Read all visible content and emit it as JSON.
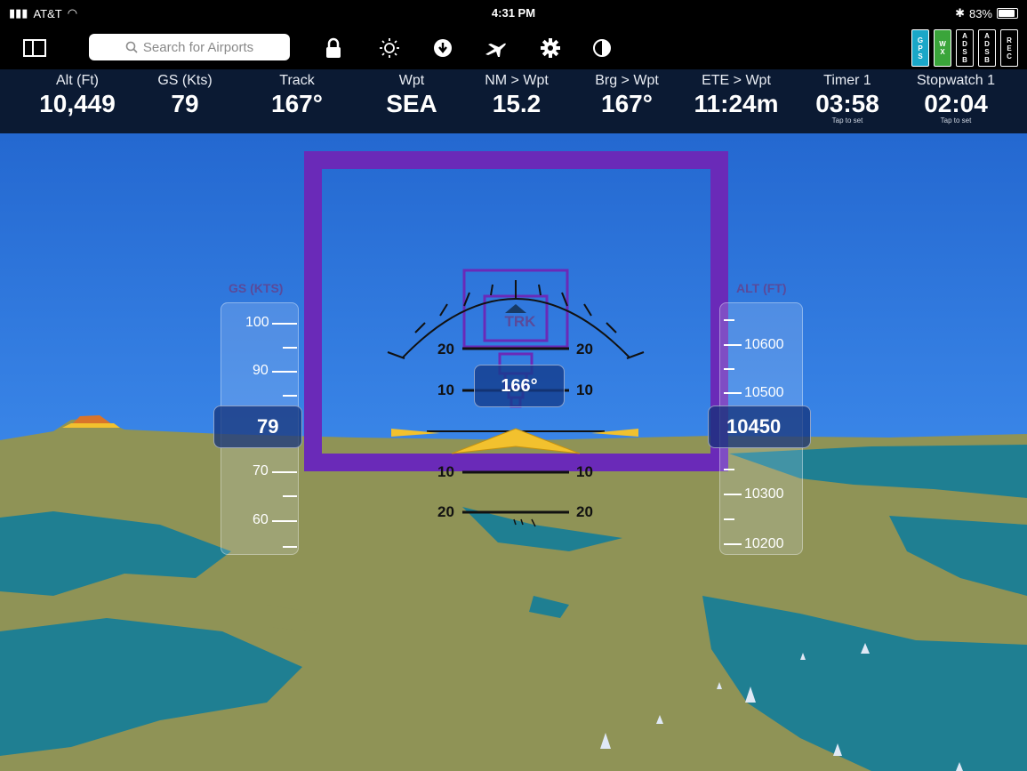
{
  "status": {
    "carrier": "AT&T",
    "time": "4:31 PM",
    "bluetooth": "✱",
    "battery": "83%"
  },
  "toolbar": {
    "search_placeholder": "Search for Airports",
    "icons": [
      "sidebar-icon",
      "lock-icon",
      "brightness-icon",
      "download-icon",
      "airplane-icon",
      "gear-icon",
      "contrast-icon"
    ],
    "badges": [
      {
        "text": "GPS",
        "color": "#1aa7c8"
      },
      {
        "text": "WX",
        "color": "#3aa53a"
      },
      {
        "text": "ADSB",
        "color": "#000000"
      },
      {
        "text": "ADSB",
        "color": "#000000"
      },
      {
        "text": "REC",
        "color": "#000000"
      }
    ]
  },
  "databar": [
    {
      "label": "Alt (Ft)",
      "value": "10,449",
      "sub": ""
    },
    {
      "label": "GS (Kts)",
      "value": "79",
      "sub": ""
    },
    {
      "label": "Track",
      "value": "167°",
      "sub": ""
    },
    {
      "label": "Wpt",
      "value": "SEA",
      "sub": ""
    },
    {
      "label": "NM > Wpt",
      "value": "15.2",
      "sub": ""
    },
    {
      "label": "Brg > Wpt",
      "value": "167°",
      "sub": ""
    },
    {
      "label": "ETE > Wpt",
      "value": "11:24m",
      "sub": ""
    },
    {
      "label": "Timer 1",
      "value": "03:58",
      "sub": "Tap to set"
    },
    {
      "label": "Stopwatch 1",
      "value": "02:04",
      "sub": "Tap to set"
    }
  ],
  "hud": {
    "trk_label": "TRK",
    "heading": "166°",
    "gs_title": "GS (KTS)",
    "alt_title": "ALT (FT)",
    "gs_readout": "79",
    "alt_readout": "10450",
    "gs_ticks": [
      "100",
      "90",
      "70",
      "60"
    ],
    "alt_ticks": [
      "10600",
      "10500",
      "10300",
      "10200"
    ],
    "pitch_labels": [
      "20",
      "10",
      "10",
      "20"
    ]
  },
  "colors": {
    "sky": "#2a6fd6",
    "ground": "#8f9356",
    "water": "#1f7f92",
    "frame": "#6a2ab8",
    "wings": "#f2c12e"
  }
}
